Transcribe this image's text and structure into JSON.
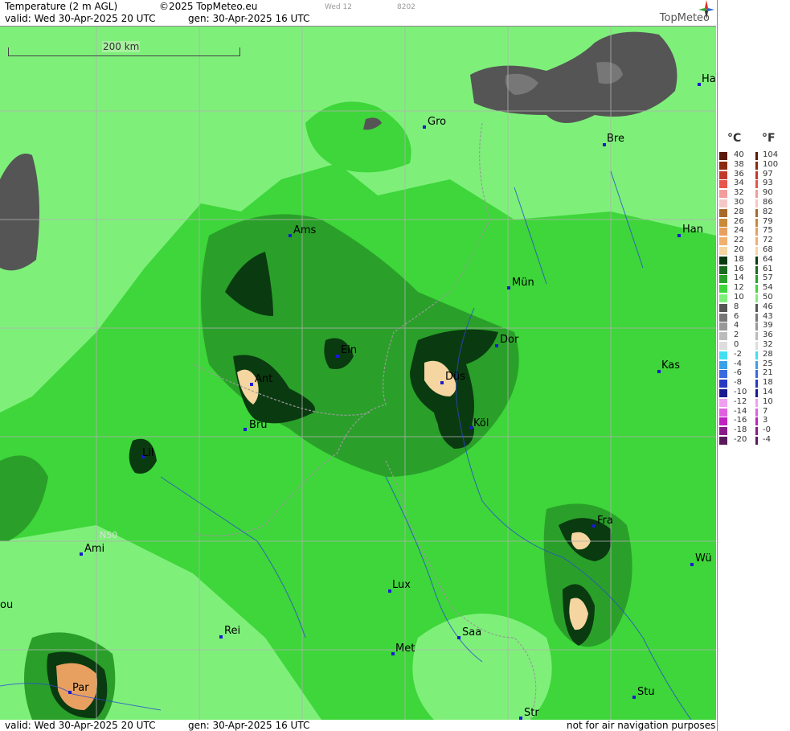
{
  "header": {
    "title": "Temperature (2 m AGL)",
    "copyright": "©2025 TopMeteo.eu",
    "step_label": "Wed 12",
    "code": "8202",
    "valid": "valid:  Wed  30-Apr-2025  20 UTC",
    "gen": "gen: 30-Apr-2025 16 UTC",
    "logo_text": "TopMeteo"
  },
  "footer": {
    "valid": "valid:  Wed  30-Apr-2025  20 UTC",
    "gen": "gen: 30-Apr-2025 16 UTC",
    "note": "not for air navigation purposes"
  },
  "map": {
    "scale_label": "200 km",
    "latitude_label": "N50",
    "cities": [
      {
        "name": "Gro"
      },
      {
        "name": "Bre"
      },
      {
        "name": "Ha"
      },
      {
        "name": "Ams"
      },
      {
        "name": "Han"
      },
      {
        "name": "Mün"
      },
      {
        "name": "Ein"
      },
      {
        "name": "Dor"
      },
      {
        "name": "Ant"
      },
      {
        "name": "Düs"
      },
      {
        "name": "Kas"
      },
      {
        "name": "Bru"
      },
      {
        "name": "Köl"
      },
      {
        "name": "Lil"
      },
      {
        "name": "Fra"
      },
      {
        "name": "Ami"
      },
      {
        "name": "Wü"
      },
      {
        "name": "Lux"
      },
      {
        "name": "Rei"
      },
      {
        "name": "Saa"
      },
      {
        "name": "Met"
      },
      {
        "name": "ou"
      },
      {
        "name": "Stu"
      },
      {
        "name": "Par"
      },
      {
        "name": "Str"
      }
    ]
  },
  "legend": {
    "unit_c": "°C",
    "unit_f": "°F",
    "rows": [
      {
        "c": "40",
        "f": "104",
        "color": "#5a1a0a"
      },
      {
        "c": "38",
        "f": "100",
        "color": "#8b2a10"
      },
      {
        "c": "36",
        "f": "97",
        "color": "#c0392b"
      },
      {
        "c": "34",
        "f": "93",
        "color": "#e8554a"
      },
      {
        "c": "32",
        "f": "90",
        "color": "#f29c9c"
      },
      {
        "c": "30",
        "f": "86",
        "color": "#f4c7c7"
      },
      {
        "c": "28",
        "f": "82",
        "color": "#a86a2a"
      },
      {
        "c": "26",
        "f": "79",
        "color": "#c98a3a"
      },
      {
        "c": "24",
        "f": "75",
        "color": "#e8a060"
      },
      {
        "c": "22",
        "f": "72",
        "color": "#f0b070"
      },
      {
        "c": "20",
        "f": "68",
        "color": "#f5d5a0"
      },
      {
        "c": "18",
        "f": "64",
        "color": "#0a3a10"
      },
      {
        "c": "16",
        "f": "61",
        "color": "#1a6a20"
      },
      {
        "c": "14",
        "f": "57",
        "color": "#2aa02a"
      },
      {
        "c": "12",
        "f": "54",
        "color": "#3ed63a"
      },
      {
        "c": "10",
        "f": "50",
        "color": "#7ef07a"
      },
      {
        "c": "8",
        "f": "46",
        "color": "#555555"
      },
      {
        "c": "6",
        "f": "43",
        "color": "#777777"
      },
      {
        "c": "4",
        "f": "39",
        "color": "#999999"
      },
      {
        "c": "2",
        "f": "36",
        "color": "#bbbbbb"
      },
      {
        "c": "0",
        "f": "32",
        "color": "#dddddd"
      },
      {
        "c": "-2",
        "f": "28",
        "color": "#40e0f0"
      },
      {
        "c": "-4",
        "f": "25",
        "color": "#3aa0e8"
      },
      {
        "c": "-6",
        "f": "21",
        "color": "#3a6ae0"
      },
      {
        "c": "-8",
        "f": "18",
        "color": "#2a3ac0"
      },
      {
        "c": "-10",
        "f": "14",
        "color": "#1a1a90"
      },
      {
        "c": "-12",
        "f": "10",
        "color": "#f0a0f0"
      },
      {
        "c": "-14",
        "f": "7",
        "color": "#e060e0"
      },
      {
        "c": "-16",
        "f": "3",
        "color": "#c020c0"
      },
      {
        "c": "-18",
        "f": "-0",
        "color": "#8a1a8a"
      },
      {
        "c": "-20",
        "f": "-4",
        "color": "#5a1a5a"
      }
    ]
  }
}
